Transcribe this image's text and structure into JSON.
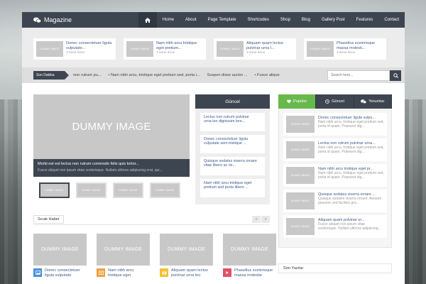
{
  "header": {
    "logo": "Magazine",
    "nav": [
      "Home",
      "About",
      "Page Template",
      "Shortcodes",
      "Shop",
      "Blog",
      "Gallery Post",
      "Features",
      "Contact"
    ]
  },
  "featured": [
    {
      "thumb": "DUMMY IMAGE",
      "title": "Donec consectetuer ligula vulputate...",
      "meta": "3 sene önce"
    },
    {
      "thumb": "DUMMY IMAGE",
      "title": "Nam nibh arcu tristique eget pretium...",
      "meta": "3 sene önce"
    },
    {
      "thumb": "DUMMY IMAGE",
      "title": "Aliquam quam lectus pulvinar urna l...",
      "meta": "3 sene önce"
    },
    {
      "thumb": "DUMMY IMAGE",
      "title": "Phasellus scelerisque massa molesti...",
      "meta": "3 sene önce"
    }
  ],
  "ticker": {
    "label": "Son Dakika",
    "items": [
      "non rutrum pu...",
      "Nam nibh arcu, tristique eget pretium sed, porta i...",
      "Suspen disse auctor ...",
      "Fusce alique"
    ],
    "search_placeholder": "Search here..."
  },
  "slider": {
    "image": "DUMMY IMAGE",
    "title": "Morbi est est lectus non rutrum commodo felis quis tortor...",
    "excerpt": "Fusce aliquet non ipsum vitae scelerisque. Nullam ultrices adipiscing erat, qui...",
    "thumbs": [
      "DUMMY IMAGE",
      "DUMMY IMAGE",
      "DUMMY IMAGE",
      "DUMMY IMAGE"
    ]
  },
  "guncel": {
    "title": "Güncel",
    "items": [
      {
        "l1": "Lectus non rutrum pulvinar",
        "l2": "urna leo dignissim lore..."
      },
      {
        "l1": "Donec consectetuer ligula",
        "l2": "vulputate sem tristique ..."
      },
      {
        "l1": "Quisque sodales viverra ornare",
        "l2": "vitae libero ac ris..."
      },
      {
        "l1": "Nam nibh arcu tristique eget",
        "l2": "pretium sed porta libero ..."
      }
    ]
  },
  "hot_news": {
    "title": "Sıcak Haber",
    "prev": "‹",
    "next": "›",
    "items": [
      {
        "image": "DUMMY IMAGE",
        "l1": "Donec consectetuer",
        "l2": "ligula vulputate",
        "icon_color": "#4a90d9"
      },
      {
        "image": "DUMMY IMAGE",
        "l1": "Nam nibh arcu",
        "l2": "tristique eget",
        "icon_color": "#f0a040"
      },
      {
        "image": "DUMMY IMAGE",
        "l1": "Aliquam quam lectus",
        "l2": "pulvinar urna leo",
        "icon_color": "#f5c030"
      },
      {
        "image": "DUMMY IMAGE",
        "l1": "Phasellus scelerisque",
        "l2": "massa molestie",
        "icon_color": "#e0506a"
      }
    ]
  },
  "sidebar": {
    "tabs": [
      "Popüler",
      "Güncel",
      "Yorumlar"
    ],
    "items": [
      {
        "thumb": "DUMMY IMAGE",
        "title": "Donec consectetuer ligula vulpu...",
        "excerpt": "Nam nibh arcu, tristique eget pretium sed, porta id quam. Praesent dig..."
      },
      {
        "thumb": "DUMMY IMAGE",
        "title": "Lectus non rutrum pulvinar urna...",
        "excerpt": "Nam nibh arcu, tristique eget pretium sed, porta id quam. Praesent dig..."
      },
      {
        "thumb": "DUMMY IMAGE",
        "title": "Nam nibh arcu tristique eget pr...",
        "excerpt": "Nam nibh arcu, tristique eget pretium sed, porta id quam. Praesent dig..."
      },
      {
        "thumb": "DUMMY IMAGE",
        "title": "Quisque sodales viverra ornare ...",
        "excerpt": "Quisque sodales viverra ornare. Aenean posuere sed facilisis gra..."
      },
      {
        "thumb": "DUMMY IMAGE",
        "title": "Aliquam quam pulvinar ur...",
        "excerpt": "Fusce aliquet non ipsum vitae scelerisque. Nullam ultrices adipiscing..."
      }
    ],
    "second_title": "Son Yazılar"
  },
  "colors": {
    "dark": "#3d4650",
    "green": "#68b94c",
    "link": "#3c5a8a"
  }
}
